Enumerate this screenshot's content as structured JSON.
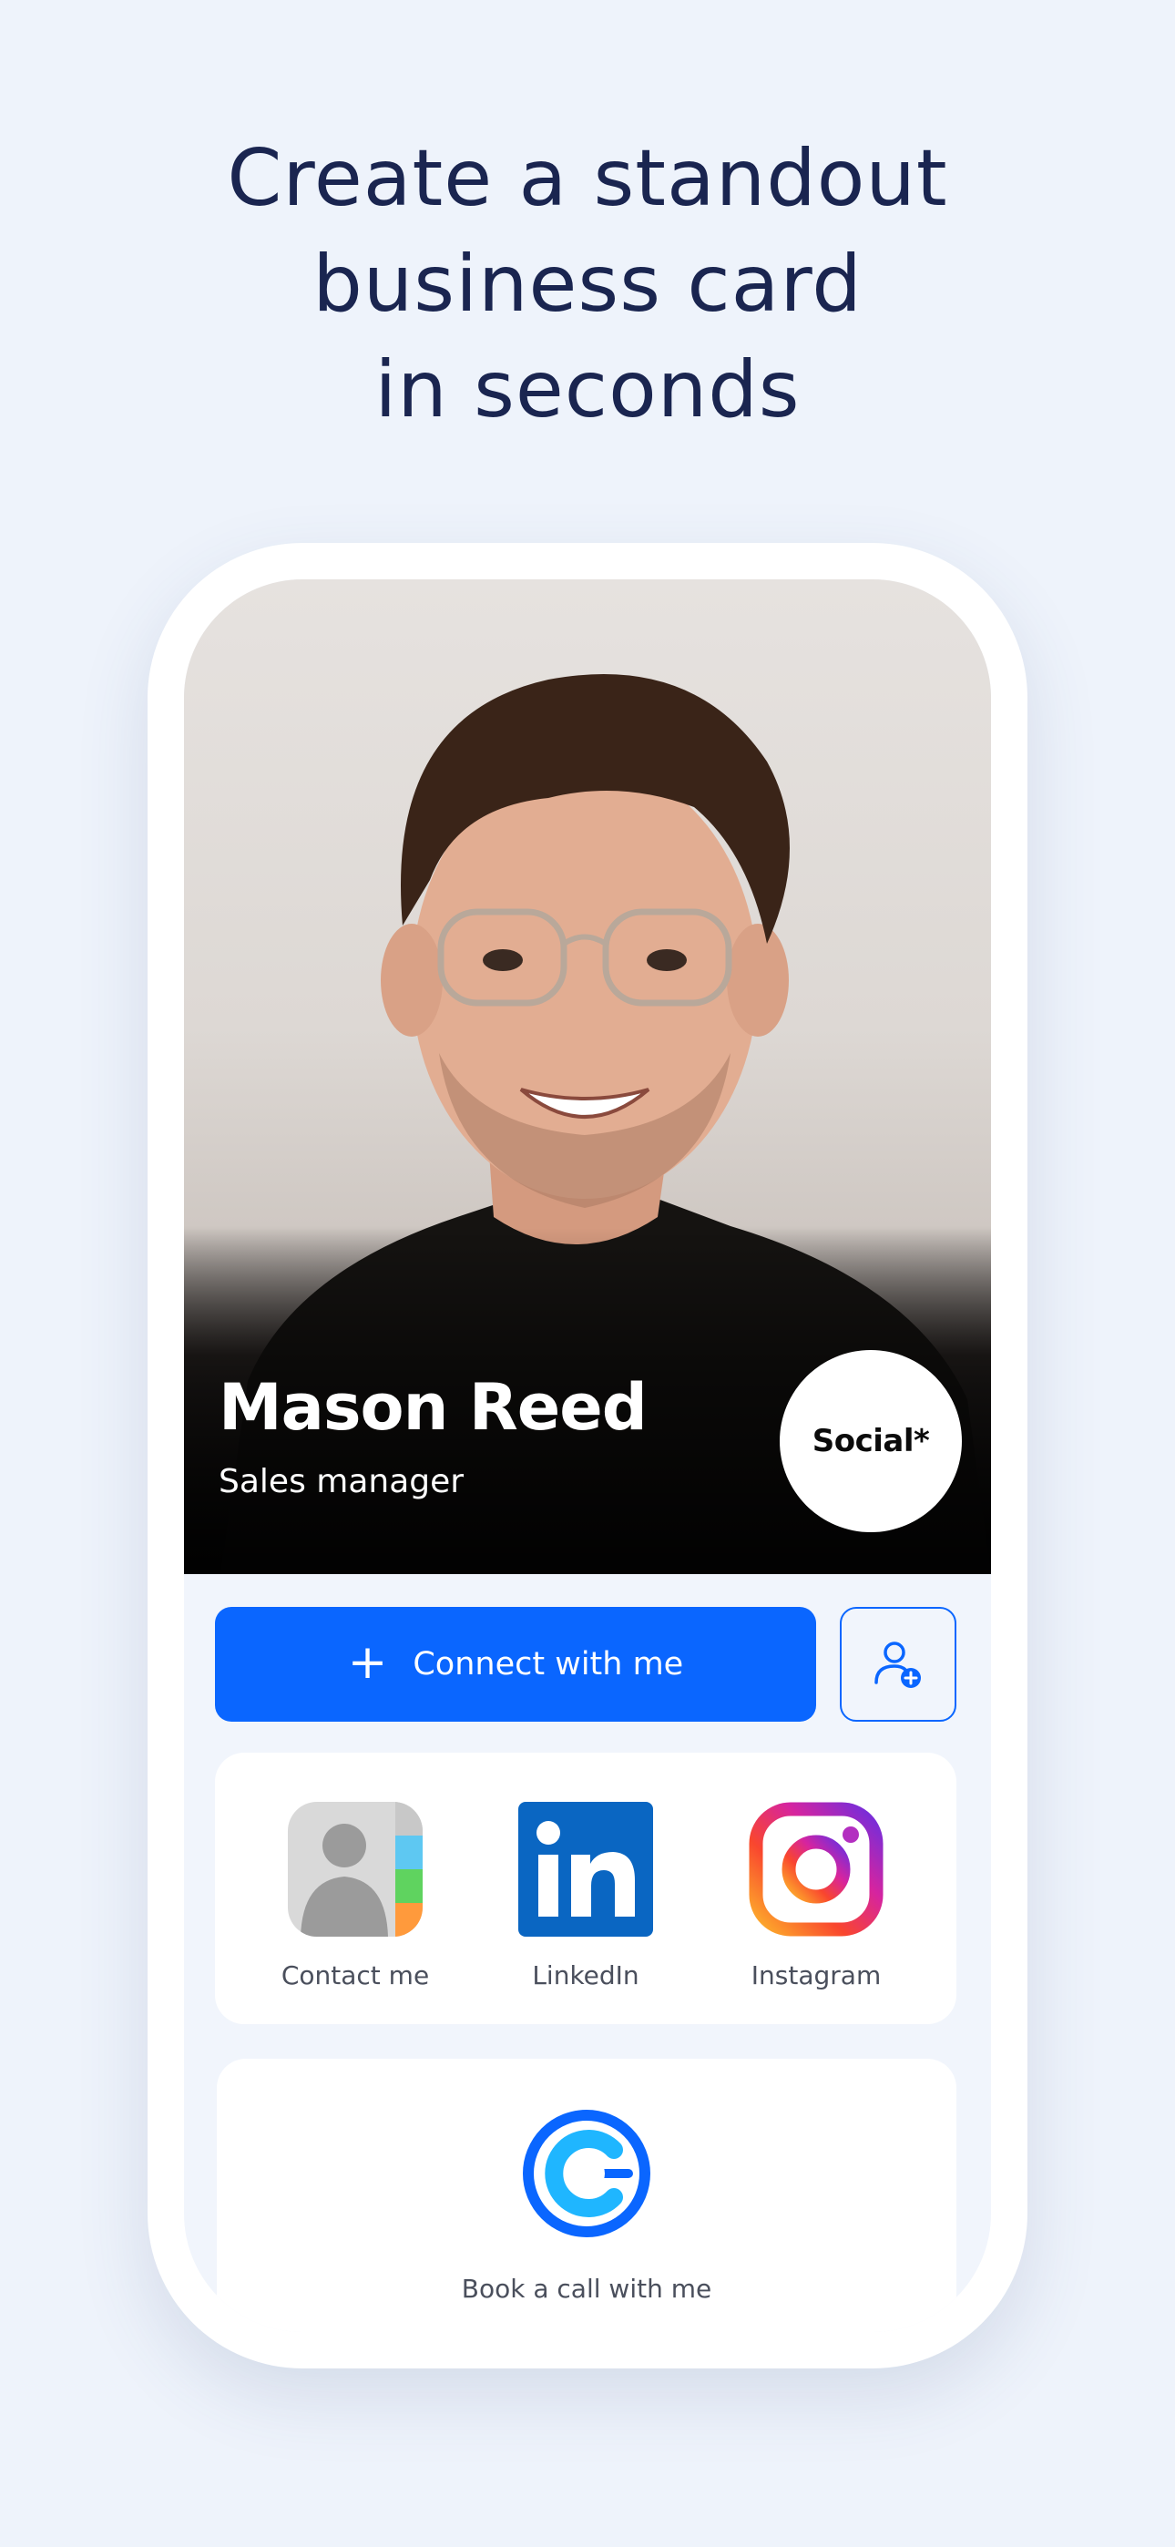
{
  "headline": {
    "line1": "Create a standout",
    "line2": "business card",
    "line3": "in seconds"
  },
  "profile": {
    "name": "Mason Reed",
    "role": "Sales manager",
    "badge": "Social*"
  },
  "actions": {
    "connect_label": "Connect with me",
    "connect_icon": "plus-icon",
    "add_contact_icon": "add-user-icon"
  },
  "links": [
    {
      "label": "Contact me",
      "icon": "contacts-app-icon"
    },
    {
      "label": "LinkedIn",
      "icon": "linkedin-icon"
    },
    {
      "label": "Instagram",
      "icon": "instagram-icon"
    }
  ],
  "booking": {
    "label": "Book a call with me",
    "icon": "calendly-icon"
  },
  "colors": {
    "background": "#eef3fb",
    "headline": "#1a2550",
    "accent": "#0a66ff",
    "linkedin": "#0a66c2"
  }
}
